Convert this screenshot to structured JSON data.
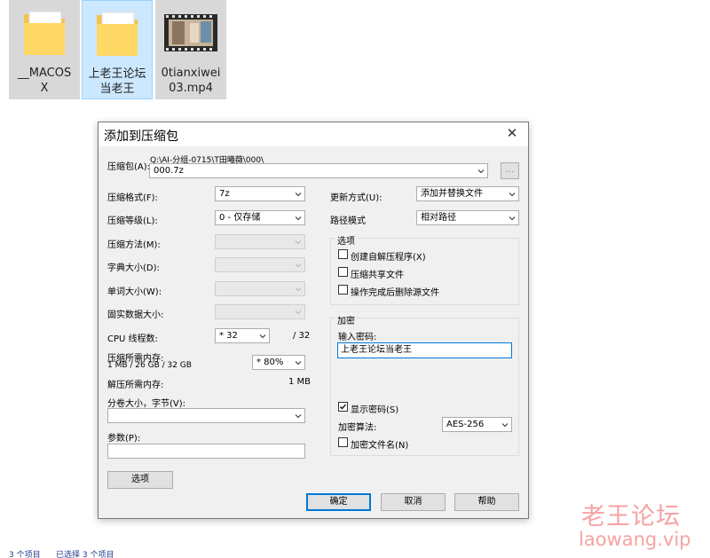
{
  "files": [
    {
      "name_line1": "__MACOS",
      "name_line2": "X",
      "icon": "folder-icon"
    },
    {
      "name_line1": "上老王论坛",
      "name_line2": "当老王",
      "icon": "folder-icon"
    },
    {
      "name_line1": "0tianxiwei",
      "name_line2": "03.mp4",
      "icon": "video-thumbnail-icon"
    }
  ],
  "dialog": {
    "title": "添加到压缩包",
    "archive": {
      "label": "压缩包(A):",
      "path": "Q:\\AI-分组-0715\\T田曦薇\\000\\",
      "filename": "000.7z",
      "browse_label": "..."
    },
    "left": {
      "format_label": "压缩格式(F):",
      "format_value": "7z",
      "level_label": "压缩等级(L):",
      "level_value": "0 - 仅存储",
      "method_label": "压缩方法(M):",
      "dict_label": "字典大小(D):",
      "word_label": "单词大小(W):",
      "solid_label": "固实数据大小:",
      "cpu_label": "CPU 线程数:",
      "cpu_value": "* 32",
      "cpu_max": "/ 32",
      "mem_comp_label": "压缩所需内存:",
      "mem_comp_detail": "1 MB / 26 GB / 32 GB",
      "mem_comp_value": "* 80%",
      "mem_decomp_label": "解压所需内存:",
      "mem_decomp_value": "1 MB",
      "split_label": "分卷大小，字节(V):",
      "split_value": "",
      "params_label": "参数(P):",
      "params_value": "",
      "options_button": "选项"
    },
    "right": {
      "update_label": "更新方式(U):",
      "update_value": "添加并替换文件",
      "path_label": "路径模式",
      "path_value": "相对路径",
      "options_group": "选项",
      "opt_sfx": "创建自解压程序(X)",
      "opt_shared": "压缩共享文件",
      "opt_delete": "操作完成后删除源文件",
      "encrypt_group": "加密",
      "password_label": "输入密码:",
      "password_value": "上老王论坛当老王",
      "show_password": "显示密码(S)",
      "show_password_checked": true,
      "algo_label": "加密算法:",
      "algo_value": "AES-256",
      "encrypt_names": "加密文件名(N)"
    },
    "buttons": {
      "ok": "确定",
      "cancel": "取消",
      "help": "帮助"
    }
  },
  "status": {
    "count": "3 个项目",
    "selected": "已选择 3 个项目"
  },
  "watermark": {
    "line1": "老王论坛",
    "line2": "laowang.vip"
  }
}
